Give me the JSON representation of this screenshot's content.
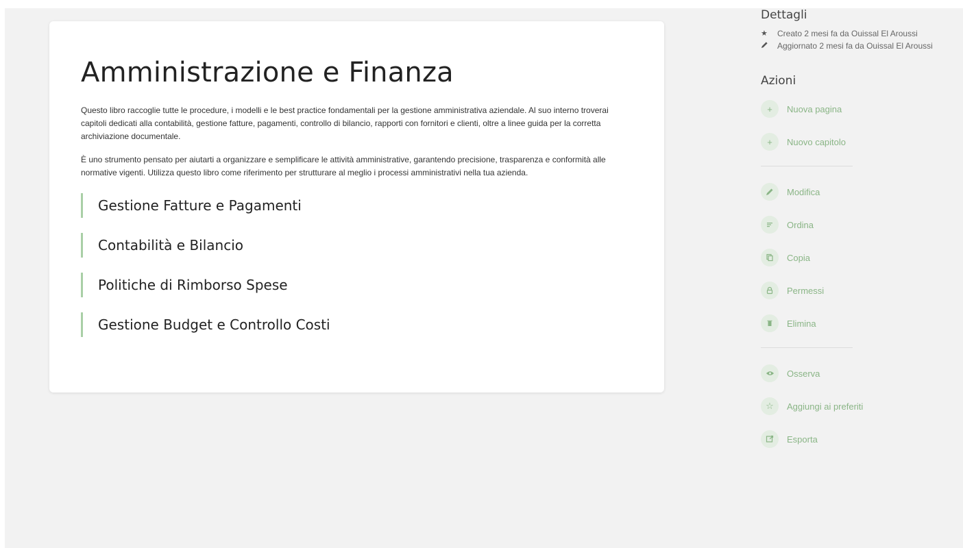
{
  "book": {
    "title": "Amministrazione e Finanza",
    "description": [
      "Questo libro raccoglie tutte le procedure, i modelli e le best practice fondamentali per la gestione amministrativa aziendale. Al suo interno troverai capitoli dedicati alla contabilità, gestione fatture, pagamenti, controllo di bilancio, rapporti con fornitori e clienti, oltre a linee guida per la corretta archiviazione documentale.",
      "È uno strumento pensato per aiutarti a organizzare e semplificare le attività amministrative, garantendo precisione, trasparenza e conformità alle normative vigenti. Utilizza questo libro come riferimento per strutturare al meglio i processi amministrativi nella tua azienda."
    ],
    "chapters": [
      {
        "label": "Gestione Fatture e Pagamenti"
      },
      {
        "label": "Contabilità e Bilancio"
      },
      {
        "label": "Politiche di Rimborso Spese"
      },
      {
        "label": "Gestione Budget e Controllo Costi"
      }
    ]
  },
  "sidebar": {
    "details_heading": "Dettagli",
    "details": [
      {
        "icon": "star-icon",
        "text": "Creato 2 mesi fa da Ouissal El Aroussi"
      },
      {
        "icon": "pencil-icon",
        "text": "Aggiornato 2 mesi fa da Ouissal El Aroussi"
      }
    ],
    "actions_heading": "Azioni",
    "actions": [
      {
        "icon": "plus-icon",
        "label": "Nuova pagina"
      },
      {
        "icon": "plus-icon",
        "label": "Nuovo capitolo"
      },
      {
        "icon": "pencil-icon",
        "label": "Modifica"
      },
      {
        "icon": "sort-icon",
        "label": "Ordina"
      },
      {
        "icon": "copy-icon",
        "label": "Copia"
      },
      {
        "icon": "lock-icon",
        "label": "Permessi"
      },
      {
        "icon": "trash-icon",
        "label": "Elimina"
      },
      {
        "icon": "eye-icon",
        "label": "Osserva"
      },
      {
        "icon": "star-outline-icon",
        "label": "Aggiungi ai preferiti"
      },
      {
        "icon": "export-icon",
        "label": "Esporta"
      }
    ]
  },
  "colors": {
    "accent": "#8ab586",
    "accent_bg": "#e3ede2",
    "chapter_border": "#a9cfa6",
    "page_bg": "#f2f2f2"
  }
}
